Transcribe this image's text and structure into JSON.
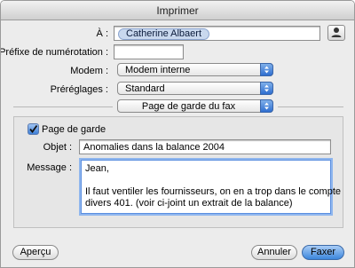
{
  "window": {
    "title": "Imprimer"
  },
  "recipient": {
    "label": "À :",
    "token": "Catherine Albaert"
  },
  "prefix": {
    "label": "Préfixe de numérotation :",
    "value": ""
  },
  "modem": {
    "label": "Modem :",
    "selected": "Modem interne"
  },
  "presets": {
    "label": "Préréglages :",
    "selected": "Standard"
  },
  "pane_select": {
    "selected": "Page de garde du fax"
  },
  "cover": {
    "checkbox_label": "Page de garde",
    "checked": true,
    "subject_label": "Objet :",
    "subject_value": "Anomalies dans la balance 2004",
    "message_label": "Message :",
    "message_lines": [
      "Jean,",
      "",
      "Il faut ventiler les fournisseurs, on en a trop dans le compte",
      "divers 401. (voir ci-joint un extrait de la balance)"
    ]
  },
  "buttons": {
    "preview": "Aperçu",
    "cancel": "Annuler",
    "fax": "Faxer"
  },
  "icons": {
    "address_book": "person-icon",
    "popup_arrows": "updown-arrows-icon",
    "check": "checkmark-icon"
  },
  "colors": {
    "accent": "#3b86dc",
    "token_bg": "#c9d8ee"
  }
}
